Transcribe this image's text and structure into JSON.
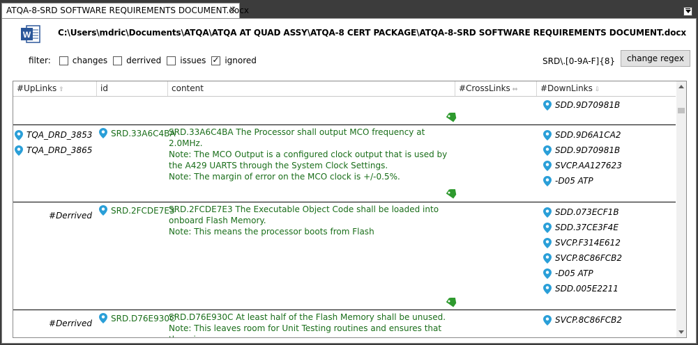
{
  "tab": {
    "title": "ATQA-8-SRD SOFTWARE REQUIREMENTS DOCUMENT.docx",
    "close_glyph": "✕"
  },
  "header": {
    "filepath": "C:\\Users\\mdric\\Documents\\ATQA\\ATQA AT QUAD ASSY\\ATQA-8 CERT PACKAGE\\ATQA-8-SRD SOFTWARE REQUIREMENTS DOCUMENT.docx",
    "icon": "word-document-icon"
  },
  "filter": {
    "label": "filter:",
    "options": [
      {
        "label": "changes",
        "checked": false
      },
      {
        "label": "derrived",
        "checked": false
      },
      {
        "label": "issues",
        "checked": false
      },
      {
        "label": "ignored",
        "checked": true
      }
    ]
  },
  "regex": {
    "value": "SRD\\.[0-9A-F]{8}",
    "button_label": "change regex"
  },
  "grid": {
    "columns": [
      "#UpLinks",
      "id",
      "content",
      "#CrossLinks",
      "#DownLinks"
    ],
    "rows": [
      {
        "uplinks": [],
        "derived": "",
        "id": "",
        "content": [],
        "downlinks": [
          "SDD.9D70981B"
        ]
      },
      {
        "uplinks": [
          "TQA_DRD_3853",
          "TQA_DRD_3865"
        ],
        "derived": "",
        "id": "SRD.33A6C4BA",
        "content": [
          "SRD.33A6C4BA     The Processor shall output MCO frequency at 2.0MHz.",
          "Note:     The MCO Output is a configured clock output that is used by the A429 UARTS through the System Clock Settings.",
          "Note:     The margin of error on the MCO clock is +/-0.5%."
        ],
        "downlinks": [
          "SDD.9D6A1CA2",
          "SDD.9D70981B",
          "SVCP.AA127623",
          "-D05 ATP"
        ]
      },
      {
        "uplinks": [],
        "derived": "#Derrived",
        "id": "SRD.2FCDE7E3",
        "content": [
          "SRD.2FCDE7E3     The Executable Object Code shall be loaded into onboard Flash Memory.",
          "Note:     This means the processor boots from Flash"
        ],
        "downlinks": [
          "SDD.073ECF1B",
          "SDD.37CE3F4E",
          "SVCP.F314E612",
          "SVCP.8C86FCB2",
          "-D05 ATP",
          "SDD.005E2211"
        ]
      },
      {
        "uplinks": [],
        "derived": "#Derrived",
        "id": "SRD.D76E930C",
        "content": [
          "SRD.D76E930C     At least half of the Flash Memory shall be unused.",
          "Note:     This leaves room for Unit Testing routines and ensures that there is"
        ],
        "downlinks": [
          "SVCP.8C86FCB2"
        ]
      }
    ]
  },
  "colors": {
    "content_green": "#1a6e1a",
    "pin_blue": "#2a9fd8",
    "tag_green": "#2e9a2e"
  }
}
